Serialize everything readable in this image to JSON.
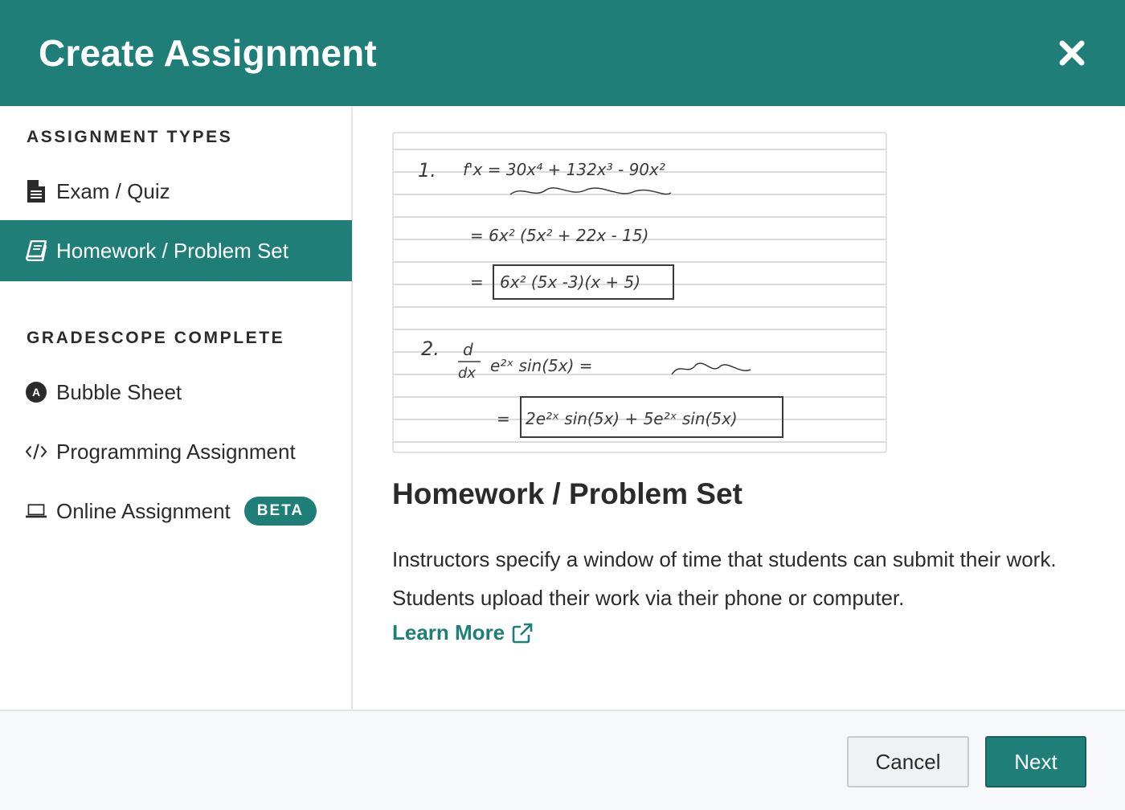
{
  "header": {
    "title": "Create Assignment"
  },
  "sidebar": {
    "section1_heading": "ASSIGNMENT TYPES",
    "section2_heading": "GRADESCOPE COMPLETE",
    "items": [
      {
        "label": "Exam / Quiz",
        "icon": "document-icon",
        "active": false
      },
      {
        "label": "Homework / Problem Set",
        "icon": "book-icon",
        "active": true
      },
      {
        "label": "Bubble Sheet",
        "icon": "bubble-a-icon",
        "active": false
      },
      {
        "label": "Programming Assignment",
        "icon": "code-icon",
        "active": false
      },
      {
        "label": "Online Assignment",
        "icon": "laptop-icon",
        "active": false,
        "badge": "BETA"
      }
    ]
  },
  "detail": {
    "title": "Homework / Problem Set",
    "description": "Instructors specify a window of time that students can submit their work. Students upload their work via their phone or computer.",
    "learn_more": "Learn More",
    "preview": {
      "lines": [
        "1.",
        "f'x = 30x⁴ + 132x³ - 90x²",
        "= 6x² (5x² + 22x - 15)",
        "=",
        "6x² (5x -3)(x + 5)",
        "2.",
        "d",
        "dx",
        "e²ˣ sin(5x) =",
        "=",
        "2e²ˣ sin(5x) + 5e²ˣ sin(5x)"
      ]
    }
  },
  "footer": {
    "cancel_label": "Cancel",
    "next_label": "Next"
  },
  "colors": {
    "brand": "#1f7f78",
    "text": "#2b2b2b"
  }
}
